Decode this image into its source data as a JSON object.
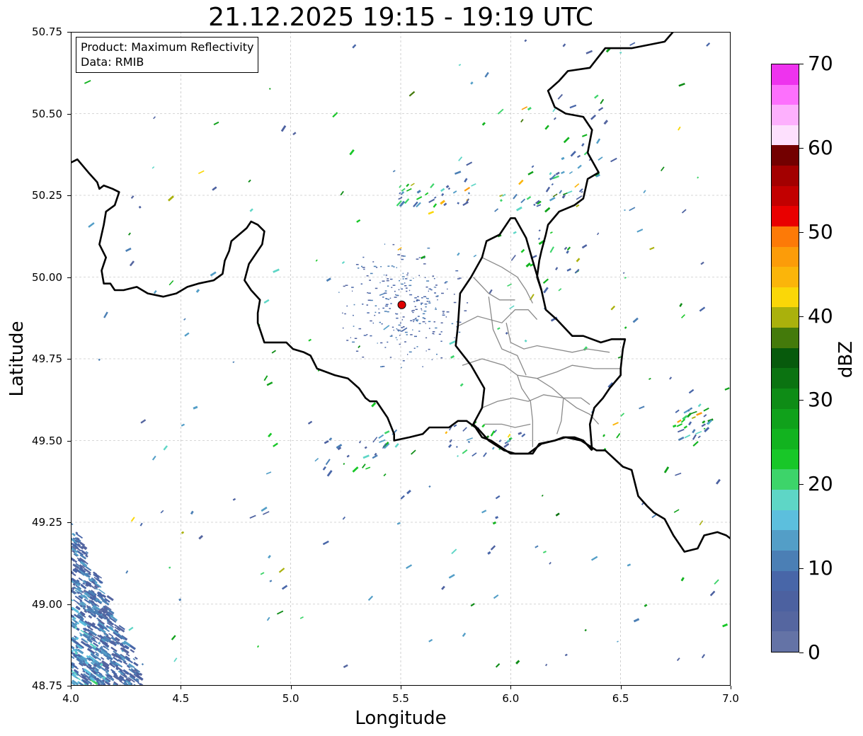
{
  "title": "21.12.2025 19:15 - 19:19 UTC",
  "info_box": {
    "product_line": "Product: Maximum Reflectivity",
    "data_line": "Data: RMIB"
  },
  "axes": {
    "xlabel": "Longitude",
    "ylabel": "Latitude",
    "xlim": [
      4.0,
      7.0
    ],
    "ylim": [
      48.75,
      50.75
    ],
    "xticks": [
      "4.0",
      "4.5",
      "5.0",
      "5.5",
      "6.0",
      "6.5",
      "7.0"
    ],
    "yticks": [
      "48.75",
      "49.00",
      "49.25",
      "49.50",
      "49.75",
      "50.00",
      "50.25",
      "50.50",
      "50.75"
    ],
    "grid": true
  },
  "radar_site": {
    "lon": 5.505,
    "lat": 49.915,
    "color": "#e00000"
  },
  "colorbar": {
    "label": "dBZ",
    "range": [
      0,
      70
    ],
    "ticks": [
      "0",
      "10",
      "20",
      "30",
      "40",
      "50",
      "60",
      "70"
    ],
    "colors": [
      "#6473a6",
      "#5566a0",
      "#4c61a0",
      "#4866a8",
      "#4b7fb5",
      "#539ec7",
      "#5cbfdd",
      "#5ed6c6",
      "#3dd46a",
      "#18c728",
      "#12b31f",
      "#10a11b",
      "#0e8c16",
      "#0b7311",
      "#075a0c",
      "#447a0b",
      "#aab10c",
      "#fad708",
      "#fbb50a",
      "#fc9c09",
      "#fd7a07",
      "#e90000",
      "#c20000",
      "#a30000",
      "#730000",
      "#fde0fd",
      "#fdb0fd",
      "#fd70fd",
      "#ee33ee"
    ]
  },
  "borders": {
    "country": [
      [
        [
          4.0,
          50.35
        ],
        [
          4.03,
          50.36
        ],
        [
          4.08,
          50.32
        ],
        [
          4.12,
          50.29
        ],
        [
          4.13,
          50.27
        ],
        [
          4.15,
          50.28
        ],
        [
          4.19,
          50.27
        ],
        [
          4.22,
          50.26
        ],
        [
          4.2,
          50.22
        ],
        [
          4.16,
          50.2
        ],
        [
          4.15,
          50.16
        ],
        [
          4.13,
          50.1
        ],
        [
          4.16,
          50.06
        ],
        [
          4.14,
          50.02
        ],
        [
          4.15,
          49.98
        ],
        [
          4.18,
          49.98
        ],
        [
          4.2,
          49.96
        ],
        [
          4.24,
          49.96
        ],
        [
          4.3,
          49.97
        ],
        [
          4.35,
          49.95
        ],
        [
          4.42,
          49.94
        ],
        [
          4.48,
          49.95
        ],
        [
          4.53,
          49.97
        ],
        [
          4.58,
          49.98
        ],
        [
          4.65,
          49.99
        ],
        [
          4.69,
          50.01
        ],
        [
          4.7,
          50.05
        ],
        [
          4.72,
          50.08
        ],
        [
          4.73,
          50.11
        ],
        [
          4.8,
          50.15
        ],
        [
          4.82,
          50.17
        ],
        [
          4.85,
          50.16
        ],
        [
          4.88,
          50.14
        ],
        [
          4.87,
          50.1
        ],
        [
          4.81,
          50.04
        ],
        [
          4.79,
          49.99
        ],
        [
          4.82,
          49.96
        ],
        [
          4.86,
          49.93
        ],
        [
          4.85,
          49.89
        ],
        [
          4.85,
          49.86
        ],
        [
          4.88,
          49.8
        ],
        [
          4.93,
          49.8
        ],
        [
          4.98,
          49.8
        ],
        [
          5.01,
          49.78
        ],
        [
          5.06,
          49.77
        ],
        [
          5.09,
          49.76
        ],
        [
          5.12,
          49.72
        ],
        [
          5.16,
          49.71
        ],
        [
          5.2,
          49.7
        ],
        [
          5.26,
          49.69
        ],
        [
          5.31,
          49.66
        ],
        [
          5.34,
          49.63
        ],
        [
          5.36,
          49.62
        ],
        [
          5.39,
          49.62
        ],
        [
          5.44,
          49.57
        ],
        [
          5.47,
          49.52
        ],
        [
          5.47,
          49.5
        ],
        [
          5.54,
          49.51
        ],
        [
          5.6,
          49.52
        ],
        [
          5.63,
          49.54
        ],
        [
          5.72,
          49.54
        ],
        [
          5.76,
          49.56
        ],
        [
          5.8,
          49.56
        ],
        [
          5.84,
          49.54
        ],
        [
          5.87,
          49.51
        ],
        [
          5.91,
          49.5
        ],
        [
          6.0,
          49.46
        ],
        [
          6.08,
          49.46
        ],
        [
          6.14,
          49.49
        ],
        [
          6.2,
          49.5
        ],
        [
          6.25,
          49.51
        ],
        [
          6.32,
          49.5
        ],
        [
          6.39,
          49.47
        ],
        [
          6.43,
          49.47
        ],
        [
          6.51,
          49.42
        ],
        [
          6.55,
          49.41
        ],
        [
          6.58,
          49.33
        ],
        [
          6.62,
          49.3
        ],
        [
          6.65,
          49.28
        ],
        [
          6.7,
          49.26
        ],
        [
          6.74,
          49.21
        ],
        [
          6.79,
          49.16
        ],
        [
          6.85,
          49.17
        ],
        [
          6.88,
          49.21
        ],
        [
          6.94,
          49.22
        ],
        [
          6.98,
          49.21
        ],
        [
          7.0,
          49.2
        ]
      ],
      [
        [
          6.99,
          51.05
        ],
        [
          6.93,
          50.95
        ],
        [
          6.83,
          50.84
        ],
        [
          6.79,
          50.79
        ],
        [
          6.7,
          50.72
        ],
        [
          6.55,
          50.7
        ],
        [
          6.43,
          50.7
        ],
        [
          6.36,
          50.64
        ],
        [
          6.26,
          50.63
        ],
        [
          6.22,
          50.6
        ],
        [
          6.17,
          50.57
        ],
        [
          6.2,
          50.52
        ],
        [
          6.25,
          50.5
        ],
        [
          6.33,
          50.49
        ],
        [
          6.35,
          50.47
        ],
        [
          6.37,
          50.45
        ],
        [
          6.35,
          50.38
        ],
        [
          6.4,
          50.32
        ],
        [
          6.35,
          50.3
        ],
        [
          6.33,
          50.24
        ],
        [
          6.29,
          50.22
        ],
        [
          6.22,
          50.2
        ],
        [
          6.17,
          50.16
        ],
        [
          6.16,
          50.13
        ],
        [
          6.14,
          50.08
        ],
        [
          6.13,
          50.05
        ],
        [
          6.12,
          50.0
        ],
        [
          6.14,
          49.96
        ],
        [
          6.16,
          49.9
        ],
        [
          6.21,
          49.87
        ],
        [
          6.28,
          49.82
        ],
        [
          6.33,
          49.82
        ],
        [
          6.37,
          49.81
        ],
        [
          6.41,
          49.8
        ],
        [
          6.46,
          49.81
        ],
        [
          6.52,
          49.81
        ],
        [
          6.51,
          49.78
        ],
        [
          6.5,
          49.72
        ],
        [
          6.5,
          49.7
        ],
        [
          6.45,
          49.66
        ],
        [
          6.42,
          49.63
        ],
        [
          6.38,
          49.6
        ],
        [
          6.36,
          49.55
        ],
        [
          6.37,
          49.47
        ]
      ]
    ],
    "luxembourg": [
      [
        6.14,
        49.96
      ],
      [
        6.1,
        50.05
      ],
      [
        6.07,
        50.12
      ],
      [
        6.02,
        50.18
      ],
      [
        6.0,
        50.18
      ],
      [
        5.95,
        50.13
      ],
      [
        5.89,
        50.11
      ],
      [
        5.87,
        50.06
      ],
      [
        5.82,
        50.0
      ],
      [
        5.77,
        49.95
      ],
      [
        5.76,
        49.85
      ],
      [
        5.75,
        49.79
      ],
      [
        5.82,
        49.73
      ],
      [
        5.88,
        49.66
      ],
      [
        5.87,
        49.6
      ],
      [
        5.83,
        49.55
      ],
      [
        5.86,
        49.53
      ],
      [
        5.9,
        49.5
      ],
      [
        5.97,
        49.47
      ],
      [
        6.02,
        49.46
      ],
      [
        6.1,
        49.46
      ],
      [
        6.13,
        49.49
      ],
      [
        6.2,
        49.5
      ],
      [
        6.24,
        49.51
      ],
      [
        6.29,
        49.51
      ],
      [
        6.33,
        49.5
      ],
      [
        6.37,
        49.47
      ]
    ],
    "admin": [
      [
        [
          5.76,
          49.85
        ],
        [
          5.85,
          49.88
        ],
        [
          5.96,
          49.86
        ],
        [
          6.02,
          49.9
        ],
        [
          6.08,
          49.9
        ],
        [
          6.12,
          49.87
        ]
      ],
      [
        [
          5.87,
          50.06
        ],
        [
          5.96,
          50.03
        ],
        [
          6.03,
          50.0
        ],
        [
          6.07,
          49.96
        ],
        [
          6.1,
          49.92
        ]
      ],
      [
        [
          5.83,
          50.0
        ],
        [
          5.9,
          49.95
        ],
        [
          5.95,
          49.93
        ],
        [
          6.02,
          49.93
        ]
      ],
      [
        [
          5.98,
          49.86
        ],
        [
          6.0,
          49.8
        ],
        [
          6.06,
          49.78
        ],
        [
          6.12,
          49.79
        ],
        [
          6.2,
          49.78
        ],
        [
          6.28,
          49.77
        ],
        [
          6.35,
          49.78
        ],
        [
          6.45,
          49.77
        ]
      ],
      [
        [
          5.78,
          49.73
        ],
        [
          5.87,
          49.75
        ],
        [
          5.97,
          49.73
        ],
        [
          6.03,
          49.7
        ],
        [
          6.12,
          49.69
        ],
        [
          6.21,
          49.71
        ],
        [
          6.28,
          49.73
        ],
        [
          6.38,
          49.72
        ],
        [
          6.5,
          49.72
        ]
      ],
      [
        [
          5.87,
          49.6
        ],
        [
          5.94,
          49.62
        ],
        [
          6.01,
          49.63
        ],
        [
          6.08,
          49.62
        ],
        [
          6.15,
          49.64
        ],
        [
          6.24,
          49.63
        ],
        [
          6.32,
          49.63
        ],
        [
          6.36,
          49.61
        ]
      ],
      [
        [
          6.03,
          49.7
        ],
        [
          6.05,
          49.66
        ],
        [
          6.09,
          49.62
        ],
        [
          6.1,
          49.56
        ],
        [
          6.1,
          49.48
        ]
      ],
      [
        [
          6.12,
          49.69
        ],
        [
          6.19,
          49.66
        ],
        [
          6.24,
          49.63
        ],
        [
          6.23,
          49.56
        ],
        [
          6.21,
          49.52
        ]
      ],
      [
        [
          5.88,
          49.55
        ],
        [
          5.96,
          49.55
        ],
        [
          6.02,
          49.54
        ],
        [
          6.09,
          49.55
        ]
      ],
      [
        [
          5.9,
          49.94
        ],
        [
          5.92,
          49.84
        ],
        [
          5.96,
          49.78
        ],
        [
          6.03,
          49.76
        ],
        [
          6.07,
          49.7
        ]
      ],
      [
        [
          6.24,
          49.63
        ],
        [
          6.3,
          49.6
        ],
        [
          6.36,
          49.58
        ],
        [
          6.4,
          49.55
        ]
      ]
    ]
  }
}
